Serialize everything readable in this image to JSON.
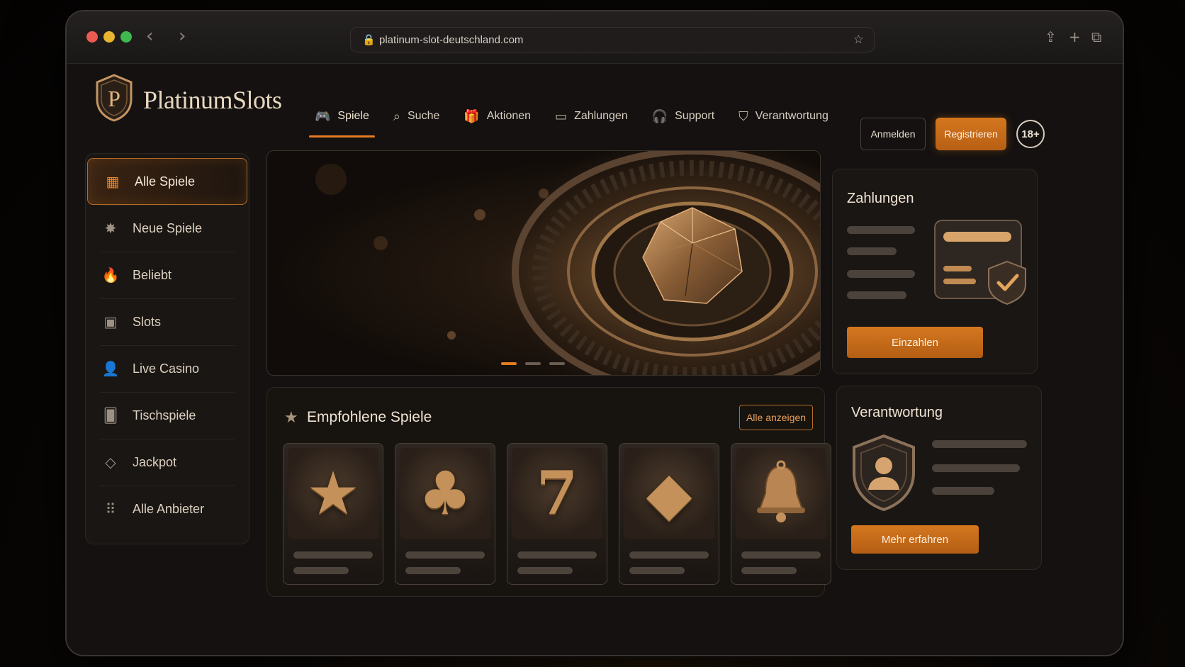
{
  "browser": {
    "url": "platinum-slot-deutschland.com",
    "back_icon": "chevron-left-icon",
    "forward_icon": "chevron-right-icon"
  },
  "header": {
    "brand": "PlatinumSlots",
    "logo_letter": "P",
    "nav": [
      {
        "label": "Spiele",
        "icon": "gamepad-icon",
        "active": true
      },
      {
        "label": "Suche",
        "icon": "search-icon"
      },
      {
        "label": "Aktionen",
        "icon": "gift-icon"
      },
      {
        "label": "Zahlungen",
        "icon": "card-icon"
      },
      {
        "label": "Support",
        "icon": "headset-icon"
      },
      {
        "label": "Verantwortung",
        "icon": "shield-icon"
      }
    ],
    "login_label": "Anmelden",
    "register_label": "Registrieren",
    "age_badge": "18+"
  },
  "sidebar": {
    "items": [
      {
        "label": "Alle Spiele",
        "icon": "grid-icon",
        "active": true
      },
      {
        "label": "Neue Spiele",
        "icon": "burst-icon"
      },
      {
        "label": "Beliebt",
        "icon": "flame-icon"
      },
      {
        "label": "Slots",
        "icon": "slot-777-icon"
      },
      {
        "label": "Live Casino",
        "icon": "dealer-icon"
      },
      {
        "label": "Tischspiele",
        "icon": "cards-icon"
      },
      {
        "label": "Jackpot",
        "icon": "diamond-icon"
      },
      {
        "label": "Alle Anbieter",
        "icon": "dots-grid-icon"
      }
    ]
  },
  "hero": {
    "slides": 3,
    "active_slide": 1
  },
  "payments": {
    "title": "Zahlungen",
    "button": "Einzahlen"
  },
  "featured": {
    "title": "Empfohlene Spiele",
    "show_all": "Alle anzeigen",
    "tiles": [
      {
        "icon": "star-icon",
        "glyph": "★"
      },
      {
        "icon": "clover-icon",
        "glyph": "♣"
      },
      {
        "icon": "seven-icon",
        "glyph": "7"
      },
      {
        "icon": "gem-icon",
        "glyph": "◆"
      },
      {
        "icon": "bell-icon",
        "glyph": "🔔"
      }
    ]
  },
  "responsibility": {
    "title": "Verantwortung",
    "button": "Mehr erfahren"
  },
  "colors": {
    "accent": "#e37b22",
    "background": "#141110",
    "panel": "#1a1613"
  }
}
